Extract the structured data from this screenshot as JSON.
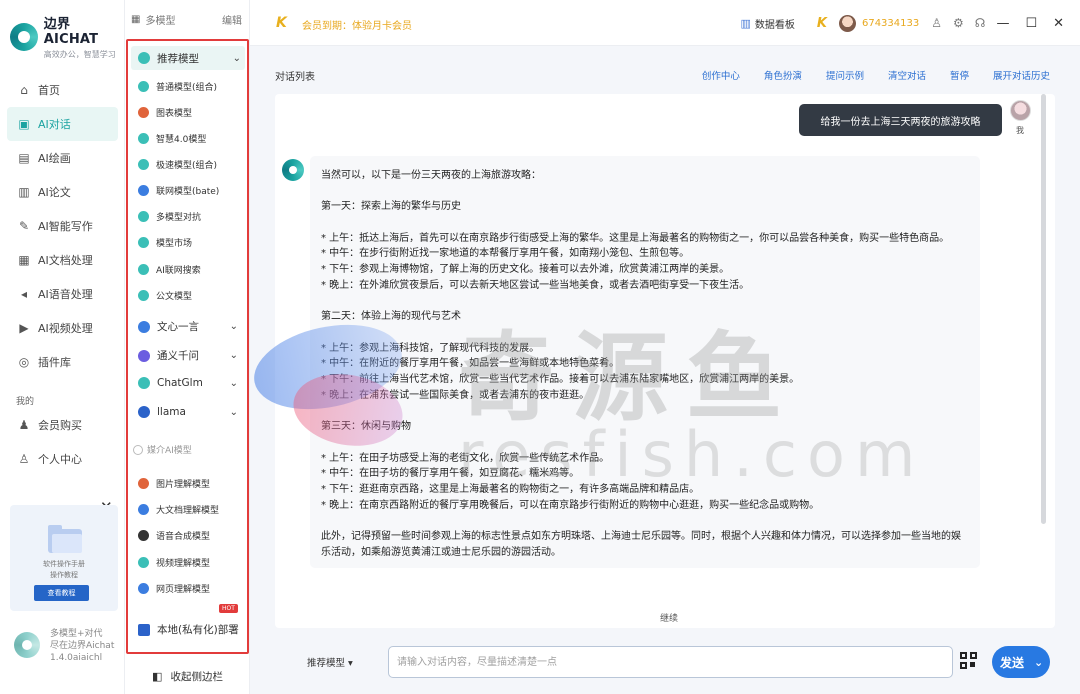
{
  "brand": {
    "title": "边界AICHAT",
    "subtitle": "高效办公，智慧学习"
  },
  "nav": {
    "items": [
      {
        "label": "首页",
        "icon": "home-icon",
        "glyph": "⌂",
        "active": false
      },
      {
        "label": "AI对话",
        "icon": "chat-icon",
        "glyph": "▣",
        "active": true
      },
      {
        "label": "AI绘画",
        "icon": "image-icon",
        "glyph": "▤",
        "active": false
      },
      {
        "label": "AI论文",
        "icon": "paper-icon",
        "glyph": "▥",
        "active": false
      },
      {
        "label": "AI智能写作",
        "icon": "pen-icon",
        "glyph": "✎",
        "active": false
      },
      {
        "label": "AI文档处理",
        "icon": "document-icon",
        "glyph": "▦",
        "active": false
      },
      {
        "label": "AI语音处理",
        "icon": "audio-icon",
        "glyph": "◂",
        "active": false
      },
      {
        "label": "AI视频处理",
        "icon": "video-icon",
        "glyph": "▶",
        "active": false
      },
      {
        "label": "插件库",
        "icon": "plugin-icon",
        "glyph": "◎",
        "active": false
      }
    ],
    "section_label": "我的",
    "my_items": [
      {
        "label": "会员购买",
        "icon": "user-icon",
        "glyph": "♟"
      },
      {
        "label": "个人中心",
        "icon": "profile-icon",
        "glyph": "♙"
      }
    ],
    "promo": {
      "line1": "软件操作手册",
      "line2": "操作教程",
      "button": "查看教程"
    },
    "footer": {
      "line1": "多模型+对代",
      "line2": "尽在边界Aichat",
      "line3": "1.4.0aiaichl"
    }
  },
  "model_panel": {
    "top_label": "多模型",
    "edit_label": "编辑",
    "groups": [
      {
        "label": "推荐模型",
        "color": "#3bbfb7",
        "expanded": true
      },
      {
        "label": "文心一言",
        "color": "#3b7de0"
      },
      {
        "label": "通义千问",
        "color": "#6b5de0"
      },
      {
        "label": "ChatGlm",
        "color": "#3bbfb7"
      },
      {
        "label": "llama",
        "color": "#2b62c9"
      }
    ],
    "recommended": [
      {
        "label": "普通模型(组合)",
        "color": "#3bbfb7"
      },
      {
        "label": "图表模型",
        "color": "#e0643b"
      },
      {
        "label": "智慧4.0模型",
        "color": "#3bbfb7"
      },
      {
        "label": "极速模型(组合)",
        "color": "#3bbfb7"
      },
      {
        "label": "联网模型(bate)",
        "color": "#3b7de0"
      },
      {
        "label": "多模型对抗",
        "color": "#3bbfb7"
      },
      {
        "label": "模型市场",
        "color": "#3bbfb7"
      },
      {
        "label": "AI联网搜索",
        "color": "#3bbfb7"
      },
      {
        "label": "公文模型",
        "color": "#3bbfb7"
      }
    ],
    "media_section": "媒介AI模型",
    "media": [
      {
        "label": "图片理解模型",
        "color": "#e0643b"
      },
      {
        "label": "大文档理解模型",
        "color": "#3b7de0"
      },
      {
        "label": "语音合成模型",
        "color": "#333333"
      },
      {
        "label": "视频理解模型",
        "color": "#3bbfb7"
      },
      {
        "label": "网页理解模型",
        "color": "#3b7de0"
      }
    ],
    "hot_badge": "HOT",
    "local_deploy": "本地(私有化)部署",
    "collapse": "收起侧边栏"
  },
  "topbar": {
    "vip_text": "会员到期：体验月卡会员",
    "dashboard": "数据看板",
    "user_id": "674334133"
  },
  "chat": {
    "list_title": "对话列表",
    "links": [
      "创作中心",
      "角色扮演",
      "提问示例",
      "清空对话",
      "暂停",
      "展开对话历史"
    ],
    "user_message": "给我一份去上海三天两夜的旅游攻略",
    "user_name": "我",
    "answer": [
      "当然可以，以下是一份三天两夜的上海旅游攻略：",
      "",
      "第一天：探索上海的繁华与历史",
      "",
      "* 上午：抵达上海后，首先可以在南京路步行街感受上海的繁华。这里是上海最著名的购物街之一，你可以品尝各种美食，购买一些特色商品。",
      "* 中午：在步行街附近找一家地道的本帮餐厅享用午餐，如南翔小笼包、生煎包等。",
      "* 下午：参观上海博物馆，了解上海的历史文化。接着可以去外滩，欣赏黄浦江两岸的美景。",
      "* 晚上：在外滩欣赏夜景后，可以去新天地区尝试一些当地美食，或者去酒吧街享受一下夜生活。",
      "",
      "第二天：体验上海的现代与艺术",
      "",
      "* 上午：参观上海科技馆，了解现代科技的发展。",
      "* 中午：在附近的餐厅享用午餐，如品尝一些海鲜或本地特色菜肴。",
      "* 下午：前往上海当代艺术馆，欣赏一些当代艺术作品。接着可以去浦东陆家嘴地区，欣赏浦江两岸的美景。",
      "* 晚上：在浦东尝试一些国际美食，或者去浦东的夜市逛逛。",
      "",
      "第三天：休闲与购物",
      "",
      "* 上午：在田子坊感受上海的老街文化，欣赏一些传统艺术作品。",
      "* 中午：在田子坊的餐厅享用午餐，如豆腐花、糯米鸡等。",
      "* 下午：逛逛南京西路，这里是上海最著名的购物街之一，有许多高端品牌和精品店。",
      "* 晚上：在南京西路附近的餐厅享用晚餐后，可以在南京路步行街附近的购物中心逛逛，购买一些纪念品或购物。",
      "",
      "此外，记得预留一些时间参观上海的标志性景点如东方明珠塔、上海迪士尼乐园等。同时，根据个人兴趣和体力情况，可以选择参加一些当地的娱乐活动，如乘船游览黄浦江或迪士尼乐园的游园活动。"
    ],
    "stop_label": "继续"
  },
  "input": {
    "model_label": "推荐模型",
    "placeholder": "请输入对话内容，尽量描述清楚一点",
    "send_label": "发送"
  },
  "watermark": {
    "cn": "奇源鱼",
    "en": "resfish.com"
  }
}
